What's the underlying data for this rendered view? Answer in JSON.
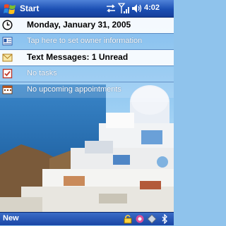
{
  "titlebar": {
    "start_label": "Start",
    "clock": "4:02"
  },
  "today": {
    "date": "Monday, January 31, 2005",
    "owner": "Tap here to set owner information",
    "messages": "Text Messages: 1 Unread",
    "tasks": "No tasks",
    "appointments": "No upcoming appointments"
  },
  "menubar": {
    "new_label": "New"
  },
  "icons": {
    "start": "windows-flag-icon",
    "sync": "sync-arrows-icon",
    "signal": "signal-strength-icon",
    "volume": "speaker-icon",
    "date": "clock-icon",
    "owner": "id-card-icon",
    "messages": "envelope-icon",
    "tasks": "checkbox-icon",
    "appointments": "calendar-icon"
  },
  "colors": {
    "titlebar": "#1c4fb3",
    "menubar": "#1a46a6",
    "sky": "#8fc3ec",
    "sea": "#1f5fa8"
  }
}
